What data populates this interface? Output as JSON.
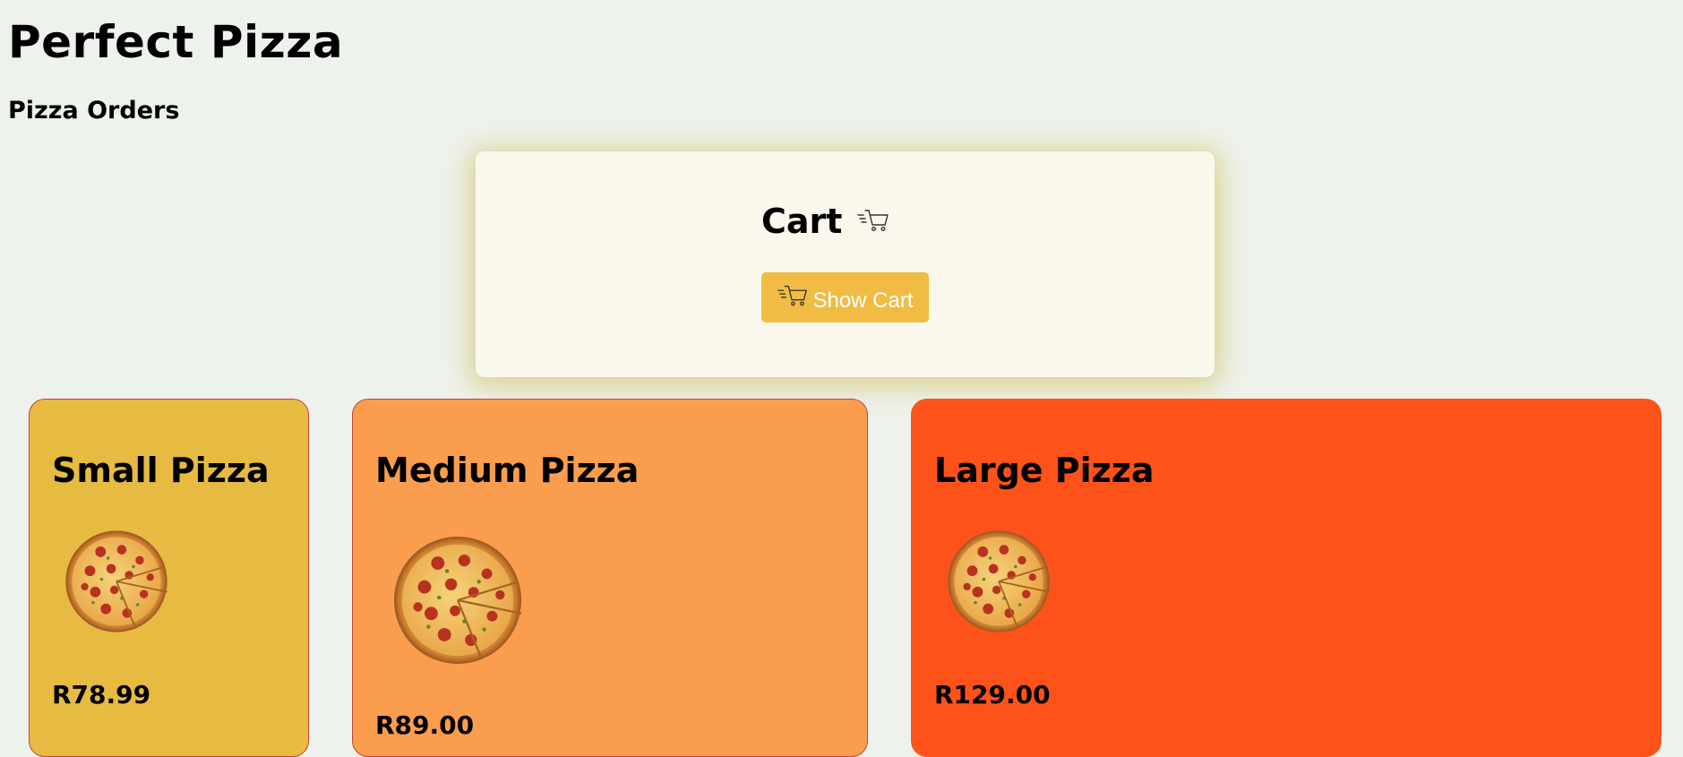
{
  "header": {
    "title": "Perfect Pizza",
    "subtitle": "Pizza Orders"
  },
  "cart": {
    "heading": "Cart",
    "heading_icon": "cart-icon",
    "button_label": "Show Cart",
    "button_icon": "cart-icon",
    "button_color": "#f0bc44"
  },
  "pizzas": [
    {
      "name": "Small Pizza",
      "price": "R78.99",
      "color": "#e7bb42"
    },
    {
      "name": "Medium Pizza",
      "price": "R89.00",
      "color": "#fb9d4e"
    },
    {
      "name": "Large Pizza",
      "price": "R129.00",
      "color": "#fe521b"
    }
  ]
}
